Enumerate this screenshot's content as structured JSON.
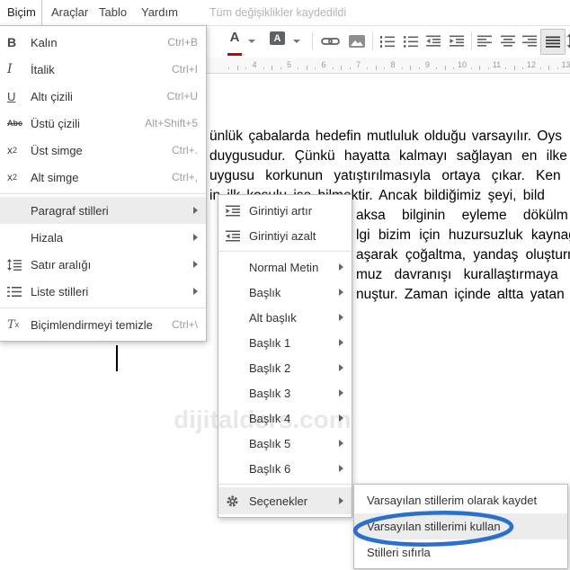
{
  "menubar": {
    "items": [
      "Biçim",
      "Araçlar",
      "Tablo",
      "Yardım"
    ],
    "status": "Tüm değişiklikler kaydedildi"
  },
  "toolbar": {
    "text_color_label": "A",
    "highlight_label": "A",
    "icons": [
      "text-color",
      "highlight-color",
      "insert-link",
      "insert-image",
      "numbered-list",
      "bulleted-list",
      "indent-decrease",
      "indent-increase",
      "align-left",
      "align-center",
      "align-right",
      "align-justify",
      "line-spacing"
    ],
    "active_icon": "align-justify"
  },
  "ruler": {
    "numbers": [
      "4",
      "5",
      "6",
      "7",
      "8",
      "9",
      "10",
      "11",
      "12",
      "13"
    ]
  },
  "format_menu": {
    "items": [
      {
        "label": "Kalın",
        "shortcut": "Ctrl+B",
        "icon": "bold-icon"
      },
      {
        "label": "İtalik",
        "shortcut": "Ctrl+I",
        "icon": "italic-icon"
      },
      {
        "label": "Altı çizili",
        "shortcut": "Ctrl+U",
        "icon": "underline-icon"
      },
      {
        "label": "Üstü çizili",
        "shortcut": "Alt+Shift+5",
        "icon": "strikethrough-icon"
      },
      {
        "label": "Üst simge",
        "shortcut": "Ctrl+.",
        "icon": "superscript-icon"
      },
      {
        "label": "Alt simge",
        "shortcut": "Ctrl+,",
        "icon": "subscript-icon"
      },
      {
        "label": "Paragraf stilleri",
        "submenu": true,
        "highlighted": true
      },
      {
        "label": "Hizala",
        "submenu": true
      },
      {
        "label": "Satır aralığı",
        "submenu": true,
        "icon": "line-spacing-icon"
      },
      {
        "label": "Liste stilleri",
        "submenu": true,
        "icon": "list-styles-icon"
      },
      {
        "label": "Biçimlendirmeyi temizle",
        "shortcut": "Ctrl+\\",
        "icon": "clear-formatting-icon"
      }
    ]
  },
  "paragraph_styles_menu": {
    "items": [
      {
        "label": "Girintiyi artır",
        "icon": "indent-increase-icon"
      },
      {
        "label": "Girintiyi azalt",
        "icon": "indent-decrease-icon"
      },
      {
        "label": "Normal Metin",
        "submenu": true
      },
      {
        "label": "Başlık",
        "submenu": true
      },
      {
        "label": "Alt başlık",
        "submenu": true
      },
      {
        "label": "Başlık 1",
        "submenu": true
      },
      {
        "label": "Başlık 2",
        "submenu": true
      },
      {
        "label": "Başlık 3",
        "submenu": true
      },
      {
        "label": "Başlık 4",
        "submenu": true
      },
      {
        "label": "Başlık 5",
        "submenu": true
      },
      {
        "label": "Başlık 6",
        "submenu": true
      },
      {
        "label": "Seçenekler",
        "submenu": true,
        "icon": "gear-icon",
        "highlighted": true
      }
    ]
  },
  "options_menu": {
    "items": [
      {
        "label": "Varsayılan stillerim olarak kaydet"
      },
      {
        "label": "Varsayılan stillerimi kullan",
        "highlighted": true,
        "circled": true
      },
      {
        "label": "Stilleri sıfırla"
      }
    ]
  },
  "document": {
    "lines": [
      "ünlük çabalarda hedefin mutluluk olduğu varsayılır. Oys",
      "duygusudur. Çünkü hayatta kalmayı sağlayan en ilke",
      "uygusu korkunun yatıştırılmasıyla ortaya çıkar. Ken",
      "in ilk koşulu ise bilmektir. Ancak bildiğimiz şeyi, bild",
      "aksa bilginin eyleme dökülm",
      "lgi bizim için huzursuzluk kaynağ",
      "aşarak çoğaltma, yandaş oluşturm",
      "muz davranışı kurallaştırmaya g",
      "nuştur. Zaman içinde altta yatan b"
    ],
    "watermark": "dijitalders.com"
  },
  "colors": {
    "ellipse_blue": "#2b70cd",
    "text_color_underline": "#cc0000",
    "menu_highlight": "#ececec"
  }
}
